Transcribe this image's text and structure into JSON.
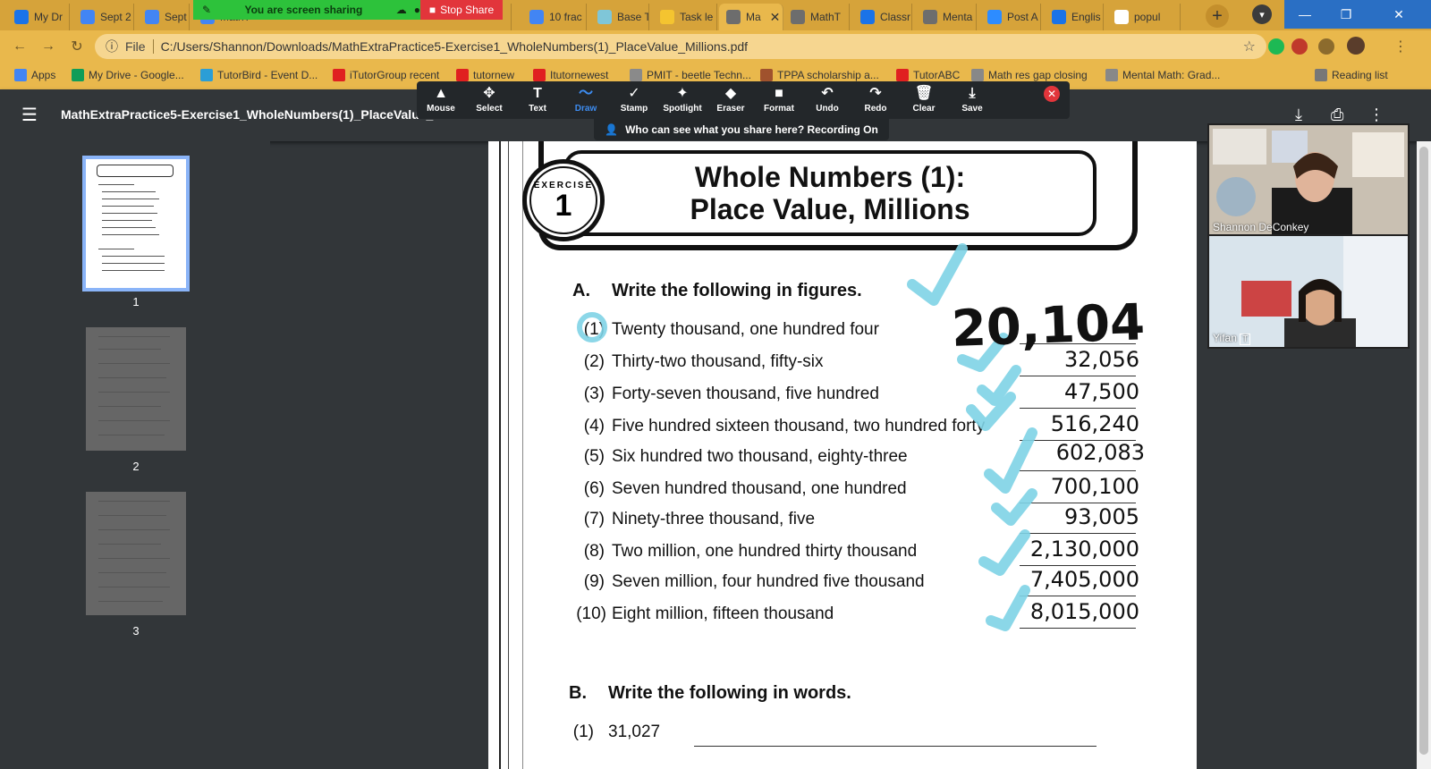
{
  "browser": {
    "tabs": [
      {
        "label": "My Dr",
        "color": "#1a73e8"
      },
      {
        "label": "Sept 2",
        "color": "#4285f4"
      },
      {
        "label": "Sept",
        "color": "#4285f4"
      },
      {
        "label": "MathT",
        "color": "#4285f4"
      },
      {
        "label": "10 frac",
        "color": "#4285f4"
      },
      {
        "label": "Base T",
        "color": "#7fc6d8"
      },
      {
        "label": "Task le",
        "color": "#f4c430"
      },
      {
        "label": "Ma",
        "color": "#6d6d6d"
      },
      {
        "label": "MathT",
        "color": "#6d6d6d"
      },
      {
        "label": "Classr",
        "color": "#1a73e8"
      },
      {
        "label": "Menta",
        "color": "#6d6d6d"
      },
      {
        "label": "Post A",
        "color": "#2d8cff"
      },
      {
        "label": "Englis",
        "color": "#1a73e8"
      },
      {
        "label": "popul",
        "color": "#ffffff"
      }
    ],
    "share_label": "You are screen sharing",
    "stop_share_label": "Stop Share",
    "url_scheme": "File",
    "url": "C:/Users/Shannon/Downloads/MathExtraPractice5-Exercise1_WholeNumbers(1)_PlaceValue_Millions.pdf",
    "bookmarks": [
      {
        "label": "Apps",
        "color": "#4285f4"
      },
      {
        "label": "My Drive - Google...",
        "color": "#0f9d58"
      },
      {
        "label": "TutorBird - Event D...",
        "color": "#2b9ed6"
      },
      {
        "label": "iTutorGroup recent",
        "color": "#e02020"
      },
      {
        "label": "tutornew",
        "color": "#e02020"
      },
      {
        "label": "Itutornewest",
        "color": "#e02020"
      },
      {
        "label": "PMIT - beetle Techn...",
        "color": "#8a8a8a"
      },
      {
        "label": "TPPA scholarship a...",
        "color": "#a0522d"
      },
      {
        "label": "TutorABC",
        "color": "#e02020"
      },
      {
        "label": "Math res gap closing",
        "color": "#888888"
      },
      {
        "label": "Mental Math: Grad...",
        "color": "#888888"
      },
      {
        "label": "Reading list",
        "color": "#777777"
      }
    ]
  },
  "pdf": {
    "title": "MathExtraPractice5-Exercise1_WholeNumbers(1)_PlaceValue_Millions.pdf",
    "thumbnails": [
      "1",
      "2",
      "3"
    ]
  },
  "zoom_toolbar": {
    "tools": [
      {
        "label": "Mouse",
        "icon": "▲"
      },
      {
        "label": "Select",
        "icon": "✥"
      },
      {
        "label": "Text",
        "icon": "T"
      },
      {
        "label": "Draw",
        "icon": "〜"
      },
      {
        "label": "Stamp",
        "icon": "✓"
      },
      {
        "label": "Spotlight",
        "icon": "✦"
      },
      {
        "label": "Eraser",
        "icon": "◆"
      },
      {
        "label": "Format",
        "icon": "■"
      },
      {
        "label": "Undo",
        "icon": "↶"
      },
      {
        "label": "Redo",
        "icon": "↷"
      },
      {
        "label": "Clear",
        "icon": "🗑"
      },
      {
        "label": "Save",
        "icon": "⤓"
      }
    ],
    "active_tool": "Draw",
    "recording_text": "Who can see what you share here? Recording On"
  },
  "document": {
    "badge_label": "EXERCISE",
    "badge_number": "1",
    "title_line1": "Whole Numbers (1):",
    "title_line2": "Place Value, Millions",
    "section_a": {
      "letter": "A.",
      "heading": "Write the following in figures."
    },
    "questions": [
      {
        "num": "(1)",
        "text": "Twenty thousand, one hundred four",
        "answer": ""
      },
      {
        "num": "(2)",
        "text": "Thirty-two thousand, fifty-six",
        "answer": "32,056"
      },
      {
        "num": "(3)",
        "text": "Forty-seven thousand, five hundred",
        "answer": "47,500"
      },
      {
        "num": "(4)",
        "text": "Five hundred sixteen thousand, two hundred forty",
        "answer": "516,240"
      },
      {
        "num": "(5)",
        "text": "Six hundred two thousand, eighty-three",
        "answer": "602,083"
      },
      {
        "num": "(6)",
        "text": "Seven hundred thousand, one hundred",
        "answer": "700,100"
      },
      {
        "num": "(7)",
        "text": "Ninety-three thousand, five",
        "answer": "93,005"
      },
      {
        "num": "(8)",
        "text": "Two million, one hundred thirty thousand",
        "answer": "2,130,000"
      },
      {
        "num": "(9)",
        "text": "Seven million, four hundred five thousand",
        "answer": "7,405,000"
      },
      {
        "num": "(10)",
        "text": "Eight million, fifteen thousand",
        "answer": "8,015,000"
      }
    ],
    "handwritten_answer": "20,104",
    "section_b": {
      "letter": "B.",
      "heading": "Write the following in words."
    },
    "b_questions": [
      {
        "num": "(1)",
        "text": "31,027"
      }
    ]
  },
  "participants": [
    {
      "name": "Shannon DeConkey"
    },
    {
      "name": "Yifan"
    }
  ],
  "colors": {
    "check_mark": "#7fd3e6",
    "tab_strip": "#d6a33a",
    "share_green": "#2dc23b",
    "stop_red": "#e2353b"
  }
}
